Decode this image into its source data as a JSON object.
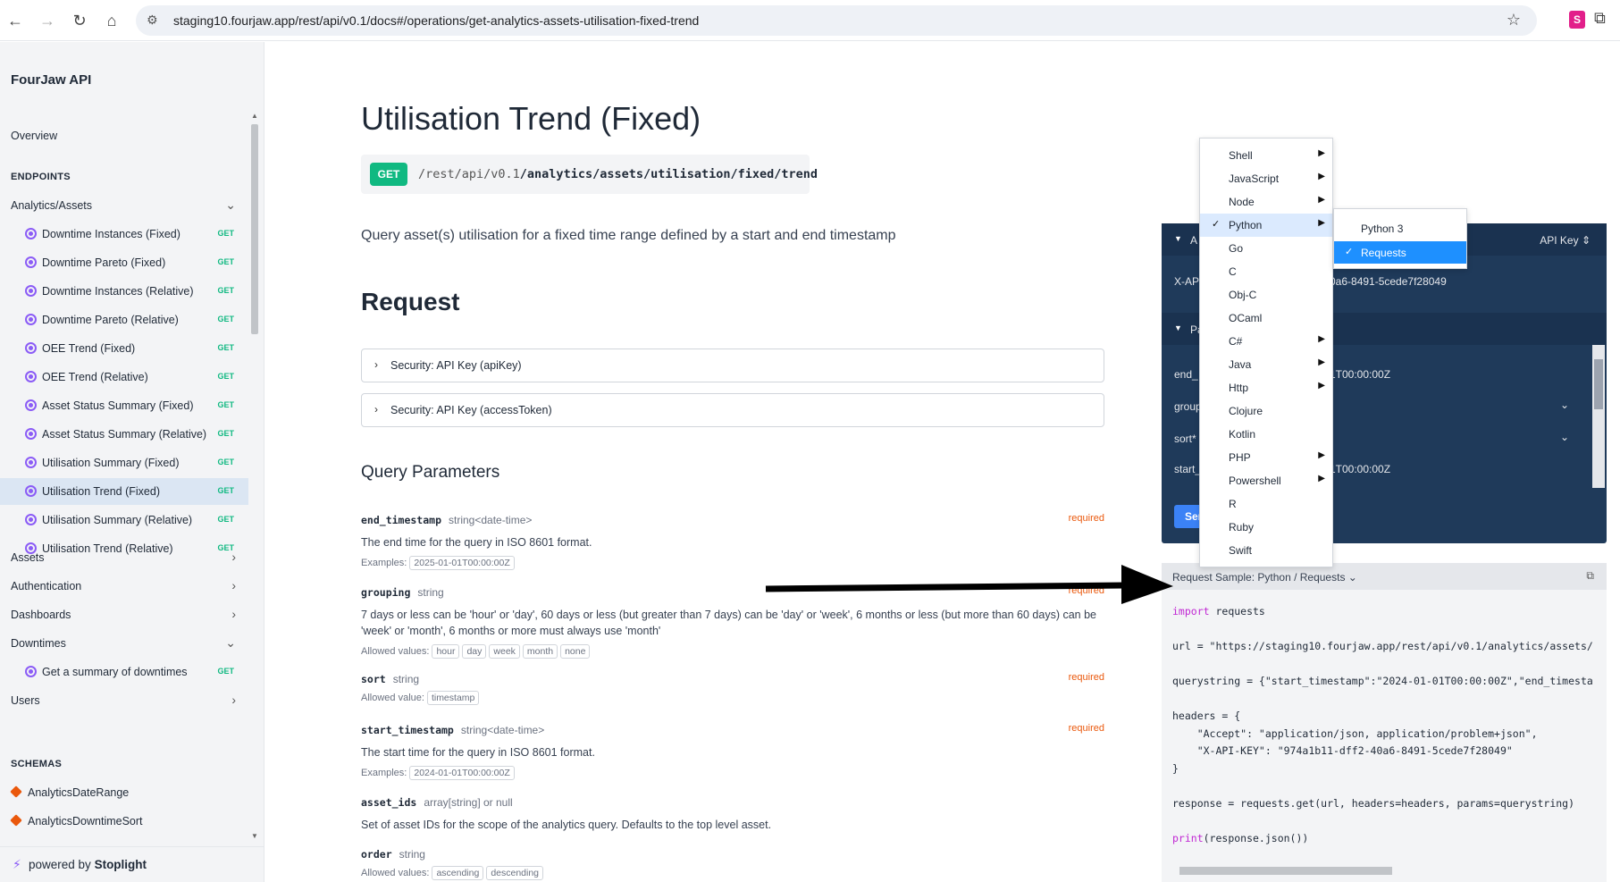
{
  "browser": {
    "url": "staging10.fourjaw.app/rest/api/v0.1/docs#/operations/get-analytics-assets-utilisation-fixed-trend",
    "extension_letter": "S"
  },
  "sidebar": {
    "title": "FourJaw API",
    "overview": "Overview",
    "endpoints_heading": "ENDPOINTS",
    "group_analytics_assets": "Analytics/Assets",
    "analytics_items": [
      {
        "label": "Downtime Instances (Fixed)",
        "method": "GET"
      },
      {
        "label": "Downtime Pareto (Fixed)",
        "method": "GET"
      },
      {
        "label": "Downtime Instances (Relative)",
        "method": "GET"
      },
      {
        "label": "Downtime Pareto (Relative)",
        "method": "GET"
      },
      {
        "label": "OEE Trend (Fixed)",
        "method": "GET"
      },
      {
        "label": "OEE Trend (Relative)",
        "method": "GET"
      },
      {
        "label": "Asset Status Summary (Fixed)",
        "method": "GET"
      },
      {
        "label": "Asset Status Summary (Relative)",
        "method": "GET"
      },
      {
        "label": "Utilisation Summary (Fixed)",
        "method": "GET"
      },
      {
        "label": "Utilisation Trend (Fixed)",
        "method": "GET"
      },
      {
        "label": "Utilisation Summary (Relative)",
        "method": "GET"
      },
      {
        "label": "Utilisation Trend (Relative)",
        "method": "GET"
      }
    ],
    "group_assets": "Assets",
    "group_authentication": "Authentication",
    "group_dashboards": "Dashboards",
    "group_downtimes": "Downtimes",
    "downtimes_item": {
      "label": "Get a summary of downtimes",
      "method": "GET"
    },
    "group_users": "Users",
    "schemas_heading": "SCHEMAS",
    "schemas": [
      "AnalyticsDateRange",
      "AnalyticsDowntimeSort"
    ],
    "powered_prefix": "powered by",
    "powered_brand": "Stoplight"
  },
  "main": {
    "title": "Utilisation Trend (Fixed)",
    "method": "GET",
    "path_prefix": "/rest/api/v0.1",
    "path_main": "/analytics/assets/utilisation/fixed/trend",
    "description": "Query asset(s) utilisation for a fixed time range defined by a start and end timestamp",
    "request_heading": "Request",
    "security_1": "Security: API Key (apiKey)",
    "security_2": "Security: API Key (accessToken)",
    "query_params_heading": "Query Parameters",
    "params": {
      "end_timestamp": {
        "name": "end_timestamp",
        "type": "string<date-time>",
        "required": "required",
        "desc": "The end time for the query in ISO 8601 format.",
        "meta_label": "Examples:",
        "chips": [
          "2025-01-01T00:00:00Z"
        ]
      },
      "grouping": {
        "name": "grouping",
        "type": "string",
        "required": "required",
        "desc": "7 days or less can be 'hour' or 'day', 60 days or less (but greater than 7 days) can be 'day' or 'week', 6 months or less (but more than 60 days) can be 'week' or 'month', 6 months or more must always use 'month'",
        "meta_label": "Allowed values:",
        "chips": [
          "hour",
          "day",
          "week",
          "month",
          "none"
        ]
      },
      "sort": {
        "name": "sort",
        "type": "string",
        "required": "required",
        "meta_label": "Allowed value:",
        "chips": [
          "timestamp"
        ]
      },
      "start_timestamp": {
        "name": "start_timestamp",
        "type": "string<date-time>",
        "required": "required",
        "desc": "The start time for the query in ISO 8601 format.",
        "meta_label": "Examples:",
        "chips": [
          "2024-01-01T00:00:00Z"
        ]
      },
      "asset_ids": {
        "name": "asset_ids",
        "type": "array[string] or null",
        "desc": "Set of asset IDs for the scope of the analytics query. Defaults to the top level asset."
      },
      "order": {
        "name": "order",
        "type": "string",
        "meta_label": "Allowed values:",
        "chips": [
          "ascending",
          "descending"
        ]
      }
    }
  },
  "try_panel": {
    "auth_label": "A",
    "api_key_selector": "API Key",
    "xapi_label": "X-AP",
    "xapi_value": "0a6-8491-5cede7f28049",
    "params_label": "Pa",
    "rows": [
      {
        "label": "end_",
        "value": "1T00:00:00Z"
      },
      {
        "label": "group",
        "value": ""
      },
      {
        "label": "sort*",
        "value": ""
      },
      {
        "label": "start_",
        "value": "1T00:00:00Z"
      }
    ],
    "send_label": "Sen"
  },
  "sample": {
    "label": "Request Sample: Python / Requests",
    "code": {
      "l1_kw": "import",
      "l1_rest": " requests",
      "l2": "url = \"https://staging10.fourjaw.app/rest/api/v0.1/analytics/assets/",
      "l3": "querystring = {\"start_timestamp\":\"2024-01-01T00:00:00Z\",\"end_timesta",
      "l4": "headers = {",
      "l5": "    \"Accept\": \"application/json, application/problem+json\",",
      "l6": "    \"X-API-KEY\": \"974a1b11-dff2-40a6-8491-5cede7f28049\"",
      "l7": "}",
      "l8": "response = requests.get(url, headers=headers, params=querystring)",
      "l9_kw": "print",
      "l9_rest": "(response.json())"
    }
  },
  "lang_menu": {
    "items": [
      {
        "label": "Shell",
        "submenu": true
      },
      {
        "label": "JavaScript",
        "submenu": true
      },
      {
        "label": "Node",
        "submenu": true
      },
      {
        "label": "Python",
        "submenu": true,
        "checked": true
      },
      {
        "label": "Go",
        "submenu": false
      },
      {
        "label": "C",
        "submenu": false
      },
      {
        "label": "Obj-C",
        "submenu": false
      },
      {
        "label": "OCaml",
        "submenu": false
      },
      {
        "label": "C#",
        "submenu": true
      },
      {
        "label": "Java",
        "submenu": true
      },
      {
        "label": "Http",
        "submenu": true
      },
      {
        "label": "Clojure",
        "submenu": false
      },
      {
        "label": "Kotlin",
        "submenu": false
      },
      {
        "label": "PHP",
        "submenu": true
      },
      {
        "label": "Powershell",
        "submenu": true
      },
      {
        "label": "R",
        "submenu": false
      },
      {
        "label": "Ruby",
        "submenu": false
      },
      {
        "label": "Swift",
        "submenu": false
      }
    ],
    "python_sub": [
      "Python 3",
      "Requests"
    ]
  },
  "colors": {
    "get_green": "#10b981",
    "accent_purple": "#8b5cf6",
    "required_orange": "#ea580c",
    "panel_navy": "#1f3a5a",
    "selected_blue": "#1e90ff"
  }
}
